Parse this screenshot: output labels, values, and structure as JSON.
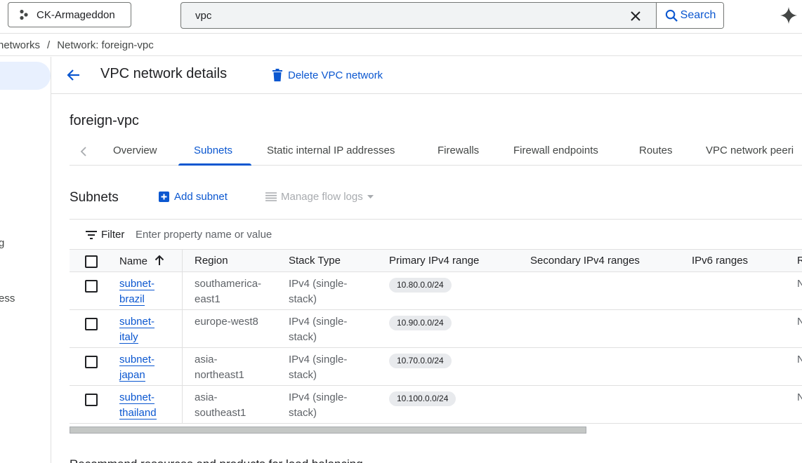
{
  "topbar": {
    "project_name": "CK-Armageddon",
    "search_value": "vpc",
    "search_label": "Search"
  },
  "breadcrumb": {
    "parent": "networks",
    "separator": "/",
    "current": "Network: foreign-vpc"
  },
  "leftnav": {
    "fragments": [
      "g",
      "ess"
    ]
  },
  "header": {
    "title": "VPC network details",
    "delete_label": "Delete VPC network"
  },
  "resource_name": "foreign-vpc",
  "tabs": [
    {
      "label": "Overview",
      "active": false
    },
    {
      "label": "Subnets",
      "active": true
    },
    {
      "label": "Static internal IP addresses",
      "active": false
    },
    {
      "label": "Firewalls",
      "active": false
    },
    {
      "label": "Firewall endpoints",
      "active": false
    },
    {
      "label": "Routes",
      "active": false
    },
    {
      "label": "VPC network peeri",
      "active": false
    }
  ],
  "subnets": {
    "title": "Subnets",
    "add_label": "Add subnet",
    "flow_logs_label": "Manage flow logs",
    "filter_label": "Filter",
    "filter_placeholder": "Enter property name or value",
    "columns": [
      "Name",
      "Region",
      "Stack Type",
      "Primary IPv4 range",
      "Secondary IPv4 ranges",
      "IPv6 ranges",
      "R"
    ],
    "rows": [
      {
        "name_1": "subnet-",
        "name_2": "brazil",
        "region_1": "southamerica-",
        "region_2": "east1",
        "stack_1": "IPv4 (single-",
        "stack_2": "stack)",
        "primary": "10.80.0.0/24",
        "edge": "N"
      },
      {
        "name_1": "subnet-",
        "name_2": "italy",
        "region_1": "europe-west8",
        "region_2": "",
        "stack_1": "IPv4 (single-",
        "stack_2": "stack)",
        "primary": "10.90.0.0/24",
        "edge": "N"
      },
      {
        "name_1": "subnet-",
        "name_2": "japan",
        "region_1": "asia-",
        "region_2": "northeast1",
        "stack_1": "IPv4 (single-",
        "stack_2": "stack)",
        "primary": "10.70.0.0/24",
        "edge": "N"
      },
      {
        "name_1": "subnet-",
        "name_2": "thailand",
        "region_1": "asia-",
        "region_2": "southeast1",
        "stack_1": "IPv4 (single-",
        "stack_2": "stack)",
        "primary": "10.100.0.0/24",
        "edge": "N"
      }
    ]
  },
  "bottom_text": "Recommend resources and products for load balancing",
  "colors": {
    "accent": "#0b57d0",
    "border": "#e0e0e0",
    "chip": "#e8eaed",
    "nav_active": "#e8f0fe"
  }
}
